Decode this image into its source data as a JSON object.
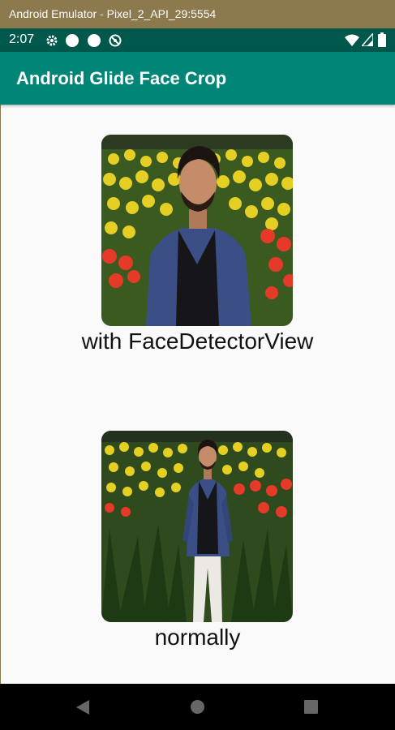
{
  "window": {
    "title": "Android Emulator - Pixel_2_API_29:5554"
  },
  "status_bar": {
    "time": "2:07",
    "left_icons": [
      "settings-icon",
      "notification-dot-icon",
      "notification-dot-icon",
      "do-not-disturb-icon"
    ],
    "right_icons": [
      "wifi-icon",
      "signal-icon",
      "battery-icon"
    ]
  },
  "app_bar": {
    "title": "Android Glide Face Crop",
    "color": "#008577",
    "status_color": "#00574b"
  },
  "images": [
    {
      "caption": "with FaceDetectorView"
    },
    {
      "caption": "normally"
    }
  ],
  "nav_bar": {
    "buttons": [
      "back-icon",
      "home-icon",
      "recents-icon"
    ]
  }
}
